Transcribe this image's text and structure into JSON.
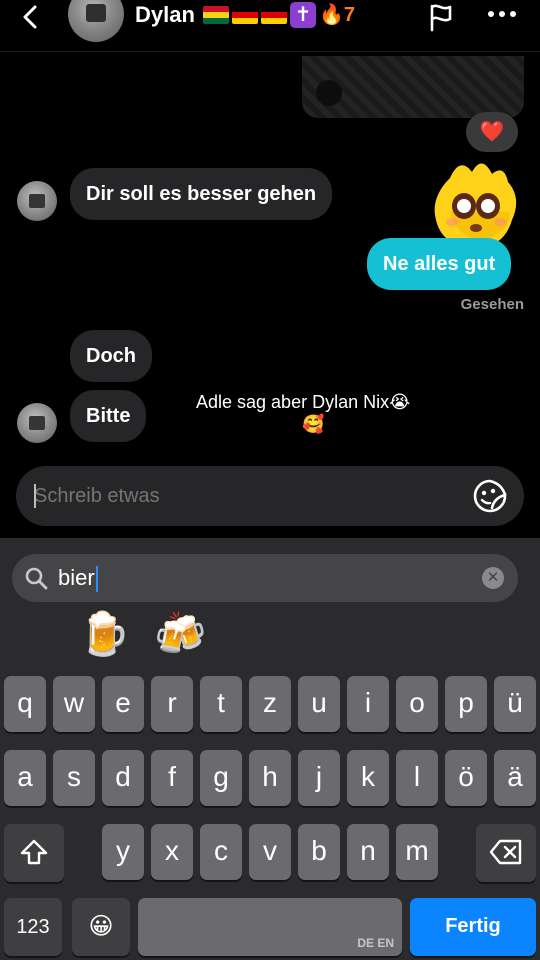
{
  "header": {
    "title": "Dylan",
    "badge_cross": "✝",
    "streak": "🔥7",
    "flag_colors": {
      "ghana": [
        "#ce1126",
        "#fcd116",
        "#006b3f"
      ],
      "germany_1": [
        "#000000",
        "#dd0000",
        "#ffce00"
      ],
      "germany_2": [
        "#000000",
        "#dd0000",
        "#ffce00"
      ]
    }
  },
  "messages": {
    "reaction": "❤️",
    "incoming_1": "Dir soll es besser gehen",
    "outgoing_1": "Ne alles gut",
    "seen": "Gesehen",
    "incoming_2": "Doch",
    "incoming_3": "Bitte"
  },
  "overlay": {
    "caption": "Adle sag aber Dylan Nix😭",
    "emoji": "🥰"
  },
  "composer": {
    "placeholder": "Schreib etwas"
  },
  "keyboard": {
    "search_value": "bier",
    "results": [
      "🍺",
      "🍻"
    ],
    "row1": [
      "q",
      "w",
      "e",
      "r",
      "t",
      "z",
      "u",
      "i",
      "o",
      "p",
      "ü"
    ],
    "row2": [
      "a",
      "s",
      "d",
      "f",
      "g",
      "h",
      "j",
      "k",
      "l",
      "ö",
      "ä"
    ],
    "row3": [
      "y",
      "x",
      "c",
      "v",
      "b",
      "n",
      "m"
    ],
    "numbers_key": "123",
    "emoji_key": "😀",
    "space_lang": "DE EN",
    "done": "Fertig"
  },
  "colors": {
    "outgoing_bubble": "#14c0d2",
    "incoming_bubble": "#262628",
    "done_key": "#0a84ff"
  }
}
